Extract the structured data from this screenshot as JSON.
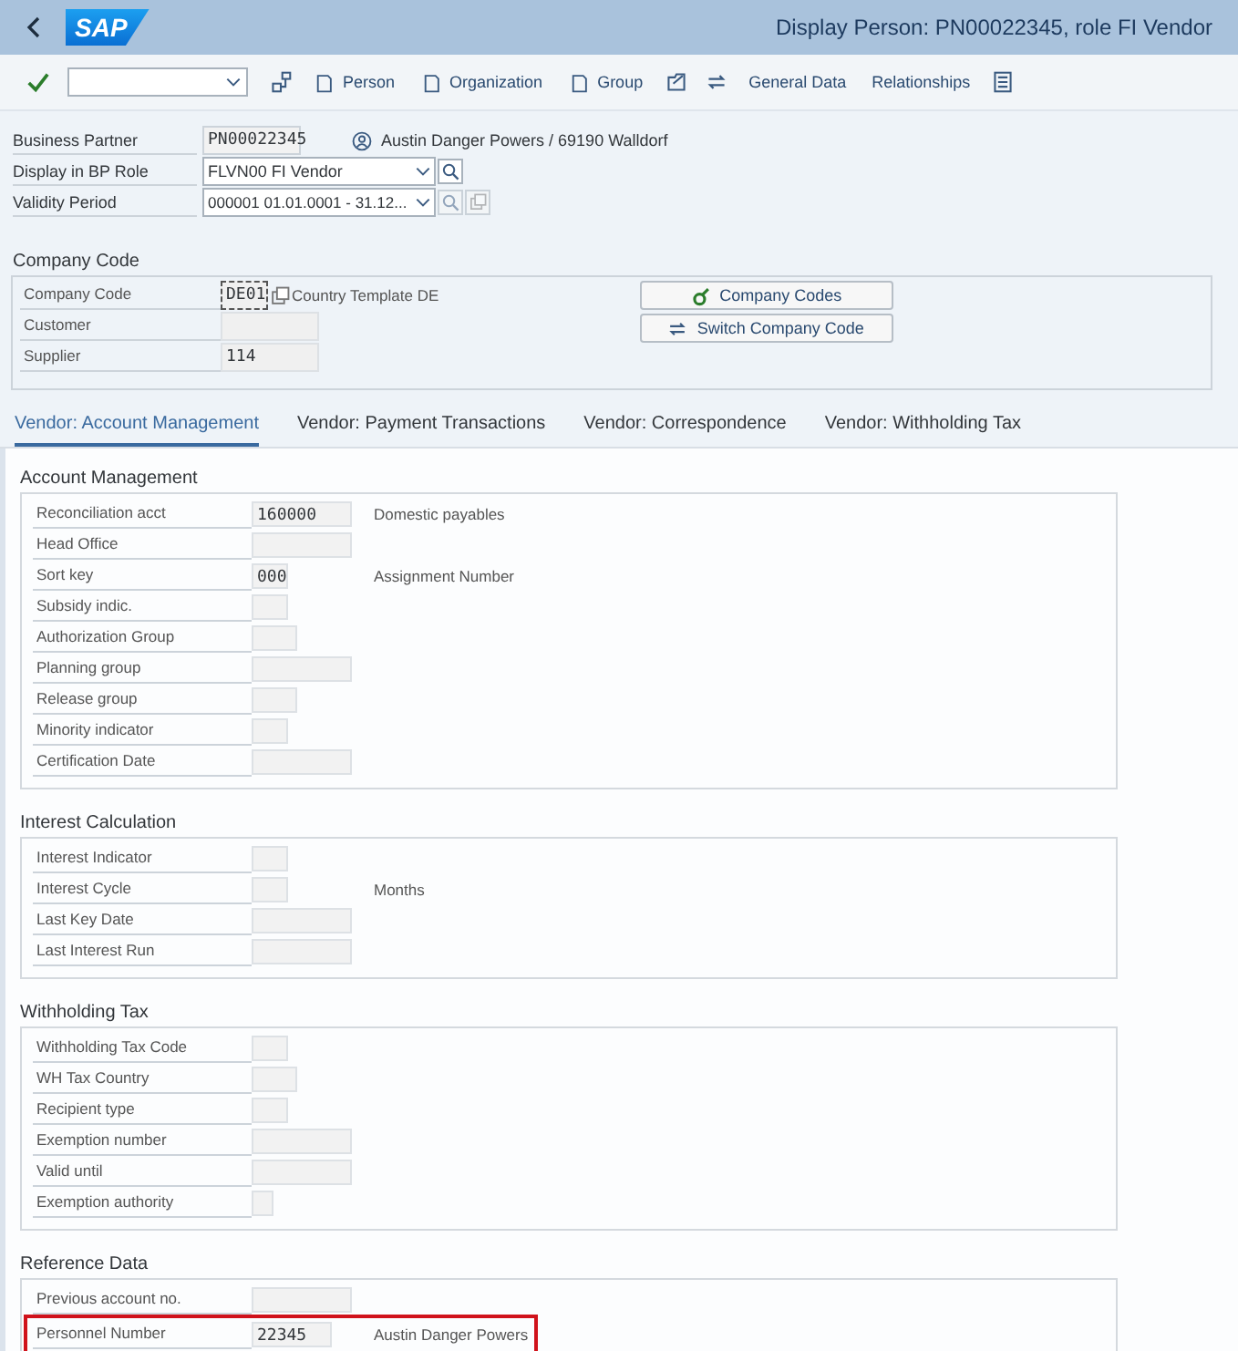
{
  "header": {
    "logo_text": "SAP",
    "title": "Display Person: PN00022345, role FI Vendor"
  },
  "toolbar": [
    {
      "kind": "check"
    },
    {
      "kind": "dropdown"
    },
    {
      "kind": "icon"
    },
    {
      "kind": "button",
      "label": "Person"
    },
    {
      "kind": "button",
      "label": "Organization"
    },
    {
      "kind": "button",
      "label": "Group"
    },
    {
      "kind": "icon"
    },
    {
      "kind": "icon"
    },
    {
      "kind": "button",
      "label": "General Data"
    },
    {
      "kind": "button",
      "label": "Relationships"
    },
    {
      "kind": "icon"
    }
  ],
  "partner": {
    "rows": [
      {
        "label": "Business Partner",
        "value": "PN00022345",
        "kind": "display",
        "description": "Austin Danger Powers / 69190 Walldorf"
      },
      {
        "label": "Display in BP Role",
        "value": "FLVN00 FI Vendor",
        "kind": "role"
      },
      {
        "label": "Validity Period",
        "value": "000001 01.01.0001 - 31.12...",
        "kind": "period"
      }
    ]
  },
  "company_code": {
    "title": "Company Code",
    "rows": [
      {
        "label": "Company Code",
        "value": "DE01",
        "kind": "focus",
        "description": "Country Template DE"
      },
      {
        "label": "Customer",
        "kind": "text"
      },
      {
        "label": "Supplier",
        "value": "114",
        "kind": "text"
      }
    ],
    "buttons": [
      {
        "label": "Company Codes"
      },
      {
        "label": "Switch Company Code"
      }
    ]
  },
  "tabs": [
    {
      "label": "Vendor: Account Management",
      "selected": true
    },
    {
      "label": "Vendor: Payment Transactions",
      "selected": false
    },
    {
      "label": "Vendor: Correspondence",
      "selected": false
    },
    {
      "label": "Vendor: Withholding Tax",
      "selected": false
    }
  ],
  "sections": [
    {
      "title": "Account Management",
      "rows": [
        {
          "label": "Reconciliation acct",
          "value": "160000",
          "kind": "text",
          "description": "Domestic payables"
        },
        {
          "label": "Head Office",
          "kind": "text"
        },
        {
          "label": "Sort key",
          "value": "000",
          "kind": "flag",
          "description": "Assignment Number"
        },
        {
          "label": "Subsidy indic.",
          "kind": "flag"
        },
        {
          "label": "Authorization Group",
          "kind": "code"
        },
        {
          "label": "Planning group",
          "kind": "text"
        },
        {
          "label": "Release group",
          "kind": "code"
        },
        {
          "label": "Minority indicator",
          "kind": "flag"
        },
        {
          "label": "Certification Date",
          "kind": "text"
        }
      ]
    },
    {
      "title": "Interest Calculation",
      "rows": [
        {
          "label": "Interest Indicator",
          "kind": "flag"
        },
        {
          "label": "Interest Cycle",
          "kind": "flag",
          "description": "Months"
        },
        {
          "label": "Last Key Date",
          "kind": "text"
        },
        {
          "label": "Last Interest Run",
          "kind": "text"
        }
      ]
    },
    {
      "title": "Withholding Tax",
      "rows": [
        {
          "label": "Withholding Tax Code",
          "kind": "flag"
        },
        {
          "label": "WH Tax Country",
          "kind": "code"
        },
        {
          "label": "Recipient type",
          "kind": "flag"
        },
        {
          "label": "Exemption number",
          "kind": "text"
        },
        {
          "label": "Valid until",
          "kind": "text"
        },
        {
          "label": "Exemption authority",
          "kind": "tiny"
        }
      ]
    },
    {
      "title": "Reference Data",
      "rows": [
        {
          "label": "Previous account no.",
          "kind": "text"
        },
        {
          "label": "Personnel Number",
          "value": "22345",
          "kind": "number",
          "description": "Austin Danger Powers",
          "highlighted": true
        }
      ]
    }
  ]
}
